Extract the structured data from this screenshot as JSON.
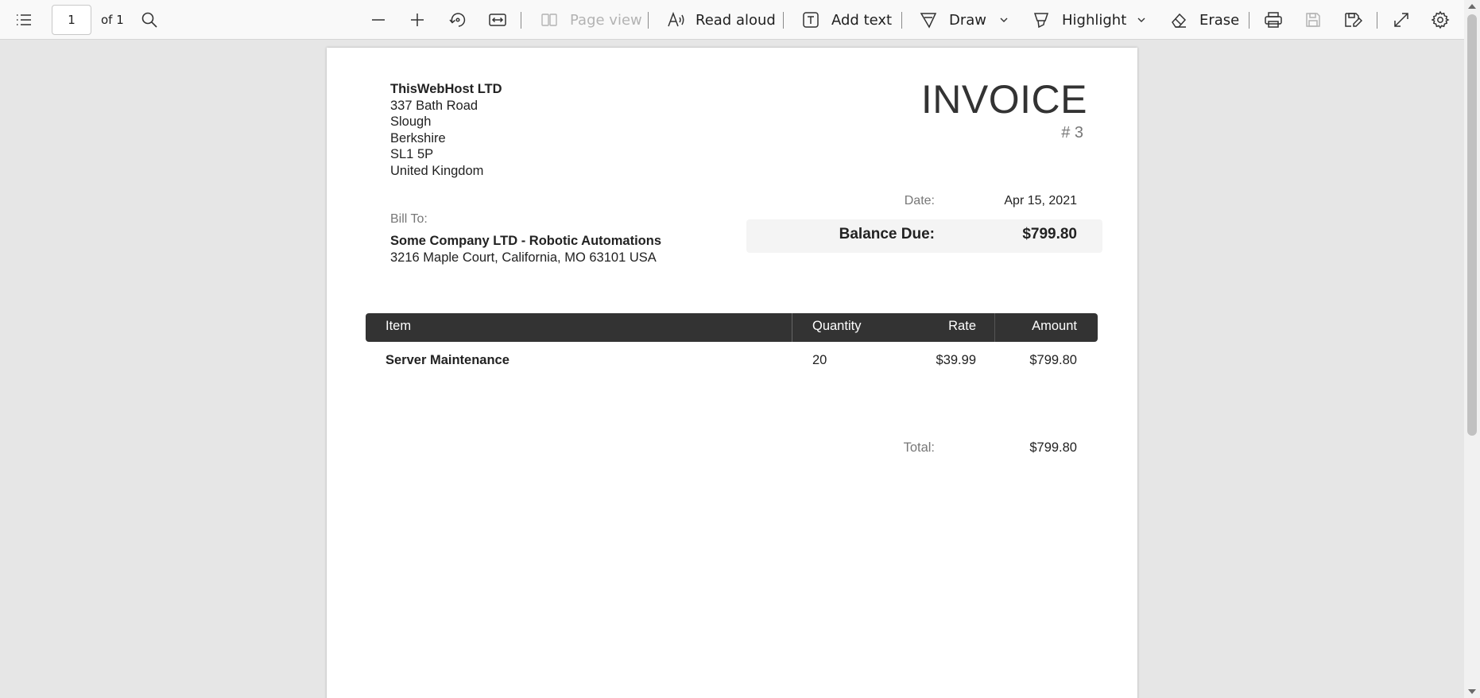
{
  "toolbar": {
    "page_number": "1",
    "page_of": "of 1",
    "page_view_label": "Page view",
    "read_aloud_label": "Read aloud",
    "add_text_label": "Add text",
    "draw_label": "Draw",
    "highlight_label": "Highlight",
    "erase_label": "Erase",
    "icons": [
      "contents-icon",
      "search-icon",
      "zoom-out-icon",
      "zoom-in-icon",
      "rotate-icon",
      "fit-width-icon",
      "page-view-icon",
      "read-aloud-icon",
      "add-text-icon",
      "draw-icon",
      "highlight-icon",
      "erase-icon",
      "print-icon",
      "save-icon",
      "save-as-icon",
      "fullscreen-icon",
      "settings-icon"
    ]
  },
  "invoice": {
    "company": {
      "name": "ThisWebHost LTD",
      "address_lines": [
        "337 Bath Road",
        "Slough",
        "Berkshire",
        "SL1 5P",
        "United Kingdom"
      ]
    },
    "title": "INVOICE",
    "number": "# 3",
    "date_label": "Date:",
    "date": "Apr 15, 2021",
    "balance_label": "Balance Due:",
    "balance": "$799.80",
    "bill_to_label": "Bill To:",
    "bill_to_name": "Some Company LTD - Robotic Automations",
    "bill_to_address": "3216 Maple Court, California, MO 63101 USA",
    "table": {
      "headers": [
        "Item",
        "Quantity",
        "Rate",
        "Amount"
      ],
      "rows": [
        {
          "item": "Server Maintenance",
          "quantity": "20",
          "rate": "$39.99",
          "amount": "$799.80"
        }
      ]
    },
    "total_label": "Total:",
    "total": "$799.80"
  },
  "colors": {
    "toolbar_bg": "#f9f9f9",
    "viewer_bg": "#e6e6e6",
    "table_header_bg": "#333333",
    "balance_box_bg": "#f4f4f4"
  }
}
